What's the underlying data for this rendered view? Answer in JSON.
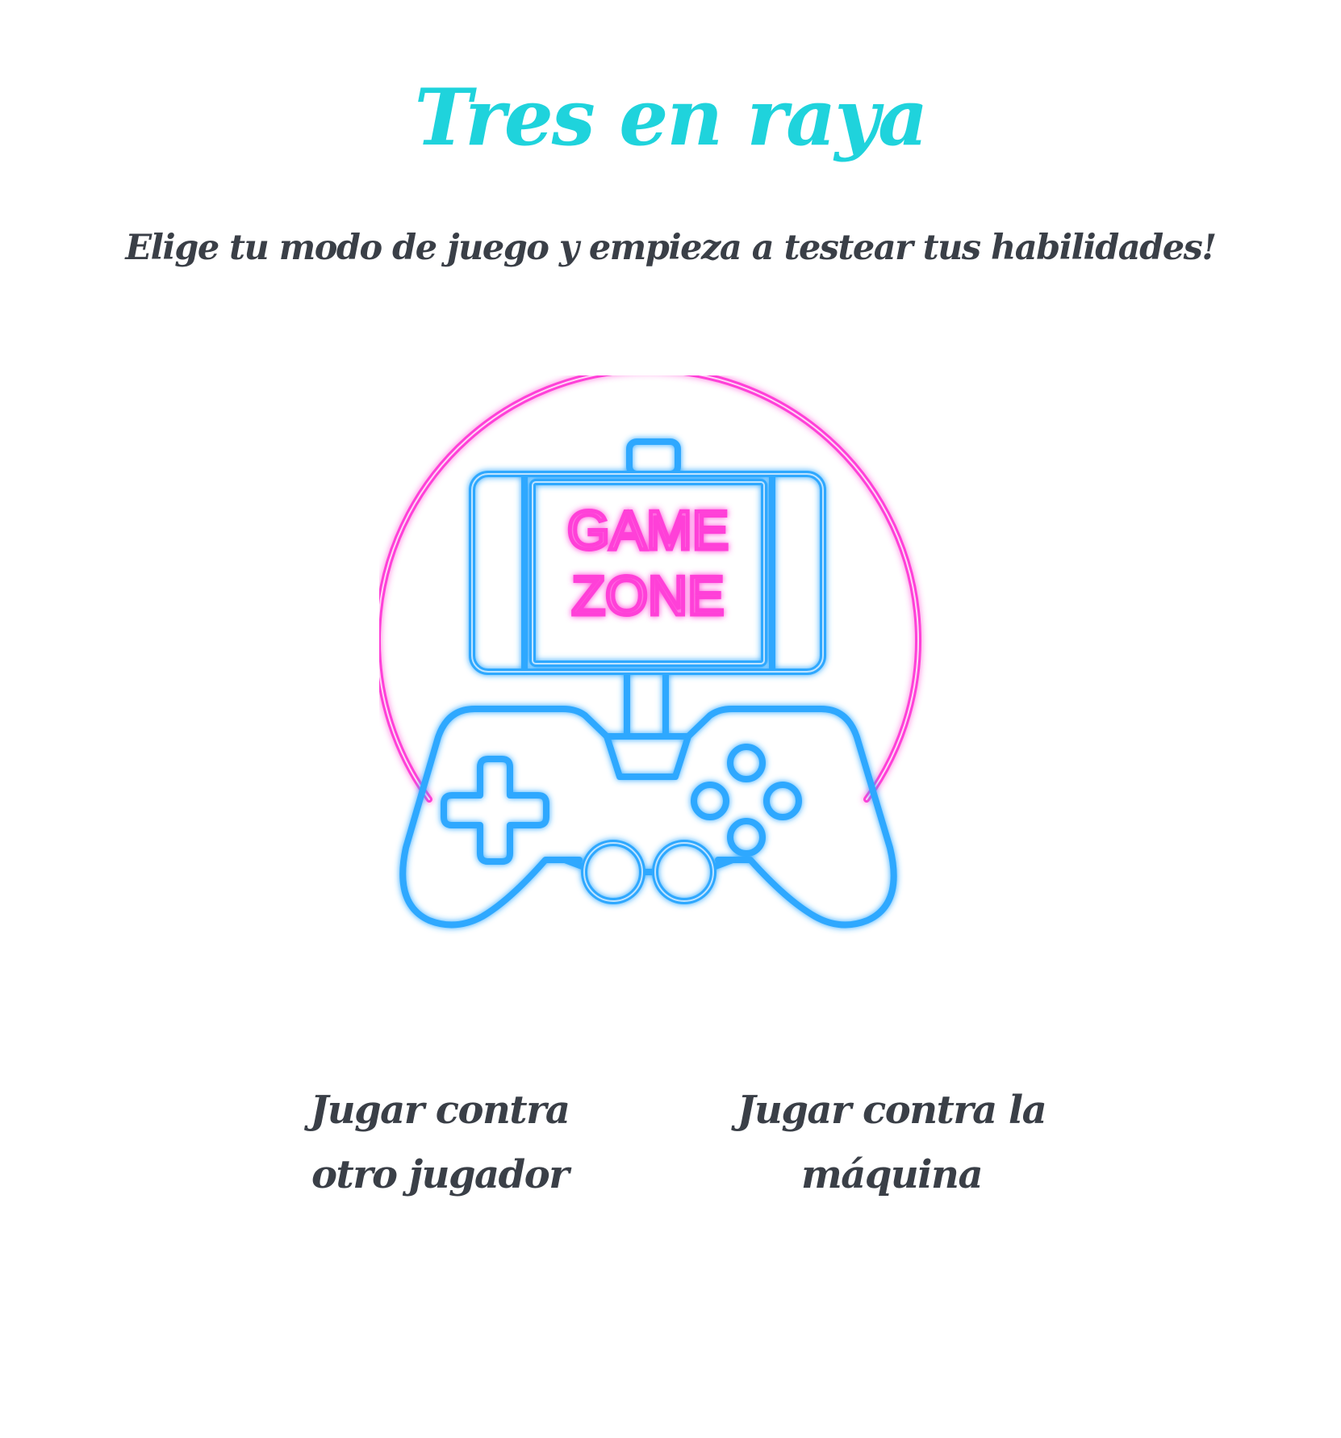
{
  "header": {
    "title": "Tres en raya",
    "subtitle": "Elige tu modo de juego y empieza a testear tus habilidades!"
  },
  "logo": {
    "icon": "game-zone-neon-logo",
    "line1": "GAME",
    "line2": "ZONE",
    "colors": {
      "ring": "#ff3fd8",
      "controller": "#2da8ff",
      "text": "#ff3fd8"
    }
  },
  "modes": {
    "vs_player": "Jugar contra otro jugador",
    "vs_machine": "Jugar contra la máquina"
  },
  "colors": {
    "title": "#1fd3dc",
    "text": "#3a3f47",
    "background": "#ffffff"
  }
}
